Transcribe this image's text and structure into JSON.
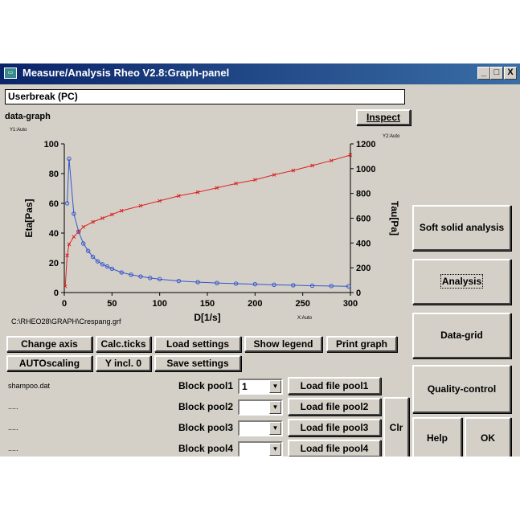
{
  "window": {
    "title": "Measure/Analysis Rheo V2.8:Graph-panel",
    "icon": "app-icon",
    "controls": {
      "minimize": "_",
      "maximize": "□",
      "close": "X"
    }
  },
  "status_text": "Userbreak (PC)",
  "graph_label": "data-graph",
  "inspect_label": "Inspect",
  "file_path": "C:\\RHEO28\\GRAPH\\Crespang.grf",
  "chart_data": {
    "type": "line",
    "title": "",
    "xlabel": "D[1/s]",
    "ylabel": "Eta[Pas]",
    "y2label": "Tau[Pa]",
    "y1_scale_note": "Y1:Auto",
    "y2_scale_note": "Y2:Auto",
    "x_scale_note": "X:Auto",
    "xlim": [
      0,
      300
    ],
    "ylim": [
      0,
      100
    ],
    "y2lim": [
      0,
      1200
    ],
    "x_ticks": [
      "0",
      "50",
      "100",
      "150",
      "200",
      "250",
      "300"
    ],
    "y_ticks": [
      "0",
      "20",
      "40",
      "60",
      "80",
      "100"
    ],
    "y2_ticks": [
      "0",
      "200",
      "400",
      "600",
      "800",
      "1000",
      "1200"
    ],
    "grid": false,
    "series": [
      {
        "axis": "y1",
        "color": "#3355cc",
        "marker": "circle",
        "x": [
          3,
          5,
          10,
          15,
          20,
          25,
          30,
          35,
          40,
          45,
          50,
          60,
          70,
          80,
          90,
          100,
          120,
          140,
          160,
          180,
          200,
          220,
          240,
          260,
          280,
          298
        ],
        "y": [
          60,
          90,
          53,
          41,
          33,
          28,
          24,
          21,
          19,
          17.5,
          16,
          13.5,
          12,
          10.8,
          9.8,
          9,
          7.8,
          7,
          6.4,
          6,
          5.6,
          5.2,
          4.9,
          4.6,
          4.4,
          4.2
        ]
      },
      {
        "axis": "y2",
        "color": "#dd2222",
        "marker": "x",
        "x": [
          1,
          3,
          5,
          10,
          15,
          20,
          30,
          40,
          50,
          60,
          80,
          100,
          120,
          140,
          160,
          180,
          200,
          220,
          240,
          260,
          280,
          300
        ],
        "y": [
          50,
          300,
          390,
          450,
          490,
          530,
          570,
          600,
          630,
          660,
          700,
          740,
          780,
          810,
          845,
          880,
          910,
          950,
          985,
          1025,
          1065,
          1110
        ]
      }
    ]
  },
  "toolbar_row1": [
    "Change axis",
    "Calc.ticks",
    "Load settings",
    "Show legend",
    "Print graph"
  ],
  "toolbar_row2": [
    "AUTOscaling",
    "Y incl. 0",
    "Save settings"
  ],
  "pools": [
    {
      "file": "shampoo.dat",
      "label": "Block pool1",
      "value": "1",
      "button": "Load file pool1"
    },
    {
      "file": ".....",
      "label": "Block pool2",
      "value": "",
      "button": "Load file pool2"
    },
    {
      "file": ".....",
      "label": "Block pool3",
      "value": "",
      "button": "Load file pool3"
    },
    {
      "file": ".....",
      "label": "Block pool4",
      "value": "",
      "button": "Load file pool4"
    }
  ],
  "clr_label": "Clr",
  "side_buttons": {
    "soft_solid": "Soft solid analysis",
    "analysis": "Analysis",
    "data_grid": "Data-grid",
    "quality": "Quality-control",
    "help": "Help",
    "ok": "OK"
  }
}
